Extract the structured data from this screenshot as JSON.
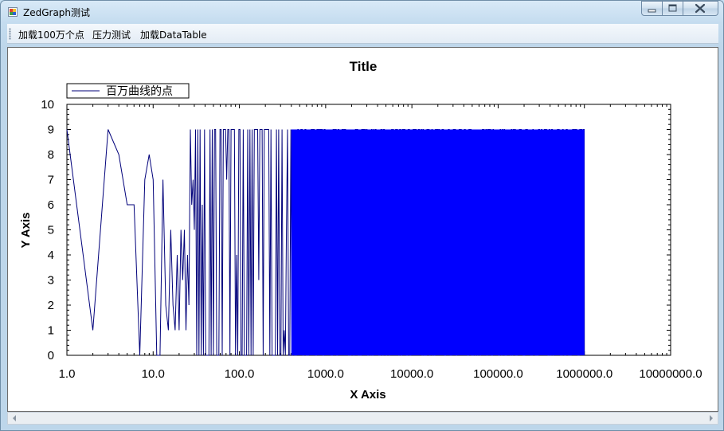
{
  "window": {
    "title": "ZedGraph测试",
    "icon": "app-window-icon"
  },
  "caption_buttons": {
    "minimize": "minimize-icon",
    "maximize": "maximize-icon",
    "close": "close-icon"
  },
  "toolbar": {
    "items": [
      {
        "label": "加载100万个点"
      },
      {
        "label": "压力测试"
      },
      {
        "label": "加载DataTable"
      }
    ]
  },
  "chart_data": {
    "type": "line",
    "title": "Title",
    "xlabel": "X Axis",
    "ylabel": "Y Axis",
    "xscale": "log",
    "xlim": [
      1,
      10000000
    ],
    "ylim": [
      0,
      10
    ],
    "xticks": [
      "1.0",
      "10.0",
      "100.0",
      "1000.0",
      "10000.0",
      "100000.0",
      "1000000.0",
      "10000000.0"
    ],
    "yticks": [
      "0",
      "1",
      "2",
      "3",
      "4",
      "5",
      "6",
      "7",
      "8",
      "9",
      "10"
    ],
    "legend": {
      "placement": "top-left",
      "entries": [
        "百万曲线的点"
      ]
    },
    "series": [
      {
        "name": "百万曲线的点",
        "color": "#0000ff",
        "point_count": 1000000,
        "x_range": [
          1,
          1000000
        ],
        "y_range": [
          0,
          9
        ],
        "initial_points": [
          {
            "x": 1,
            "y": 9
          },
          {
            "x": 2,
            "y": 1
          },
          {
            "x": 3,
            "y": 9
          },
          {
            "x": 4,
            "y": 8
          },
          {
            "x": 5,
            "y": 6
          },
          {
            "x": 6,
            "y": 6
          },
          {
            "x": 7,
            "y": 0
          },
          {
            "x": 8,
            "y": 7
          },
          {
            "x": 9,
            "y": 8
          },
          {
            "x": 10,
            "y": 7
          },
          {
            "x": 11,
            "y": 0
          },
          {
            "x": 12,
            "y": 0
          },
          {
            "x": 13,
            "y": 7
          },
          {
            "x": 14,
            "y": 2
          },
          {
            "x": 15,
            "y": 1
          },
          {
            "x": 16,
            "y": 5
          },
          {
            "x": 17,
            "y": 2
          },
          {
            "x": 18,
            "y": 1
          },
          {
            "x": 19,
            "y": 4
          },
          {
            "x": 20,
            "y": 1
          },
          {
            "x": 21,
            "y": 5
          },
          {
            "x": 22,
            "y": 3
          },
          {
            "x": 23,
            "y": 5
          },
          {
            "x": 24,
            "y": 1
          },
          {
            "x": 25,
            "y": 4
          },
          {
            "x": 26,
            "y": 2
          },
          {
            "x": 27,
            "y": 9
          },
          {
            "x": 28,
            "y": 6
          },
          {
            "x": 29,
            "y": 7
          },
          {
            "x": 30,
            "y": 5
          },
          {
            "x": 31,
            "y": 9
          },
          {
            "x": 32,
            "y": 0
          },
          {
            "x": 33,
            "y": 9
          }
        ]
      }
    ]
  }
}
